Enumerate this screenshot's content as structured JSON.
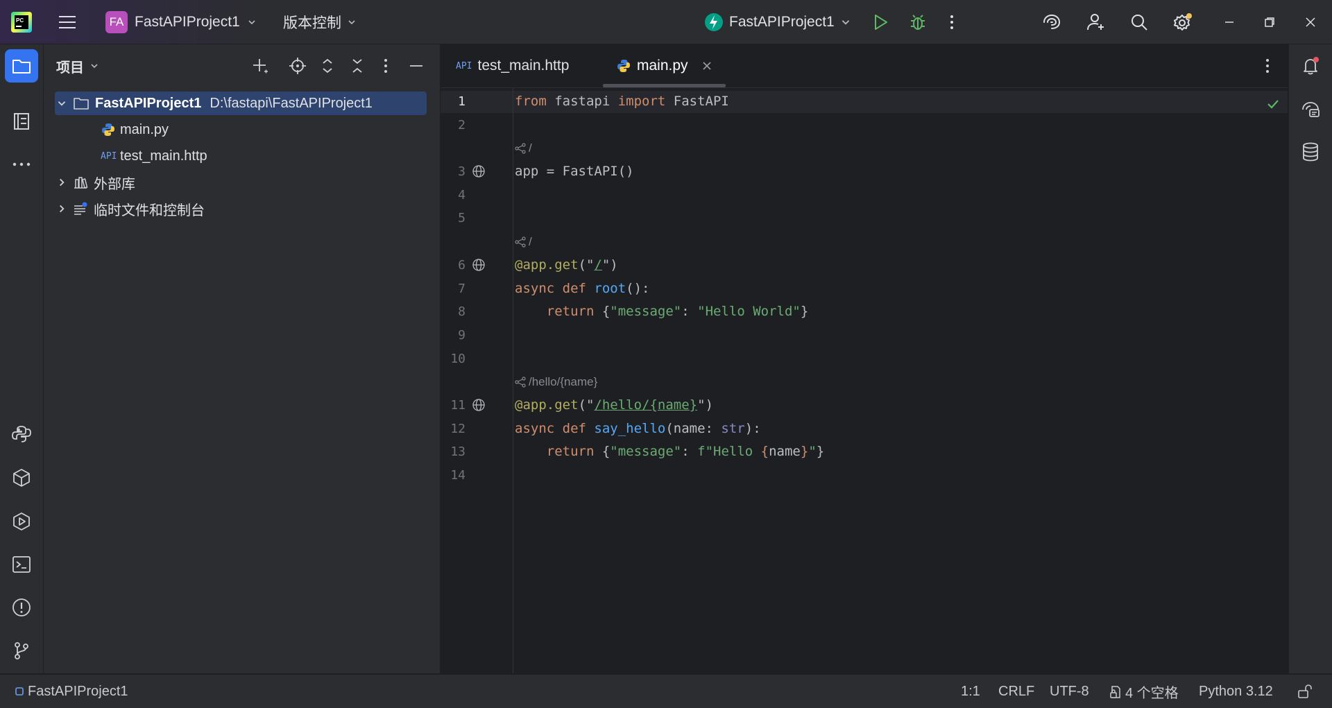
{
  "titlebar": {
    "project_badge": "FA",
    "project_name": "FastAPIProject1",
    "vcs_label": "版本控制",
    "run_config": "FastAPIProject1"
  },
  "panel": {
    "title": "项目",
    "tree": [
      {
        "label": "FastAPIProject1",
        "path": "D:\\fastapi\\FastAPIProject1"
      },
      {
        "label": "main.py"
      },
      {
        "label": "test_main.http",
        "badge": "API"
      },
      {
        "label": "外部库"
      },
      {
        "label": "临时文件和控制台"
      }
    ]
  },
  "tabs": [
    {
      "label": "test_main.http",
      "badge": "API",
      "active": false
    },
    {
      "label": "main.py",
      "active": true
    }
  ],
  "editor": {
    "line_numbers": [
      "1",
      "2",
      "3",
      "4",
      "5",
      "6",
      "7",
      "8",
      "9",
      "10",
      "11",
      "12",
      "13",
      "14"
    ],
    "inlay_hints": [
      "/",
      "/",
      "/hello/{name}"
    ],
    "code": {
      "l1": [
        "from",
        " fastapi ",
        "import",
        " FastAPI"
      ],
      "l3": "app = FastAPI()",
      "l6": [
        "@app.get",
        "(\"",
        "/",
        "\")"
      ],
      "l7": [
        "async def ",
        "root",
        "():"
      ],
      "l8": [
        "    return ",
        "{",
        "\"message\"",
        ": ",
        "\"Hello World\"",
        "}"
      ],
      "l11": [
        "@app.get",
        "(\"",
        "/hello/{name}",
        "\")"
      ],
      "l12": [
        "async def ",
        "say_hello",
        "(name: ",
        "str",
        "):"
      ],
      "l13": [
        "    return ",
        "{",
        "\"message\"",
        ": ",
        "f\"Hello ",
        "{",
        "name",
        "}",
        "\"",
        "}"
      ]
    }
  },
  "statusbar": {
    "project": "FastAPIProject1",
    "position": "1:1",
    "line_sep": "CRLF",
    "encoding": "UTF-8",
    "indent": "4 个空格",
    "interpreter": "Python 3.12"
  },
  "colors": {
    "keyword": "#cf8e6d",
    "string": "#6aab73",
    "decorator": "#b3ae60",
    "function": "#56a8f5",
    "builtin": "#8888c6",
    "accent": "#3574f0",
    "selection": "#2e436e"
  }
}
